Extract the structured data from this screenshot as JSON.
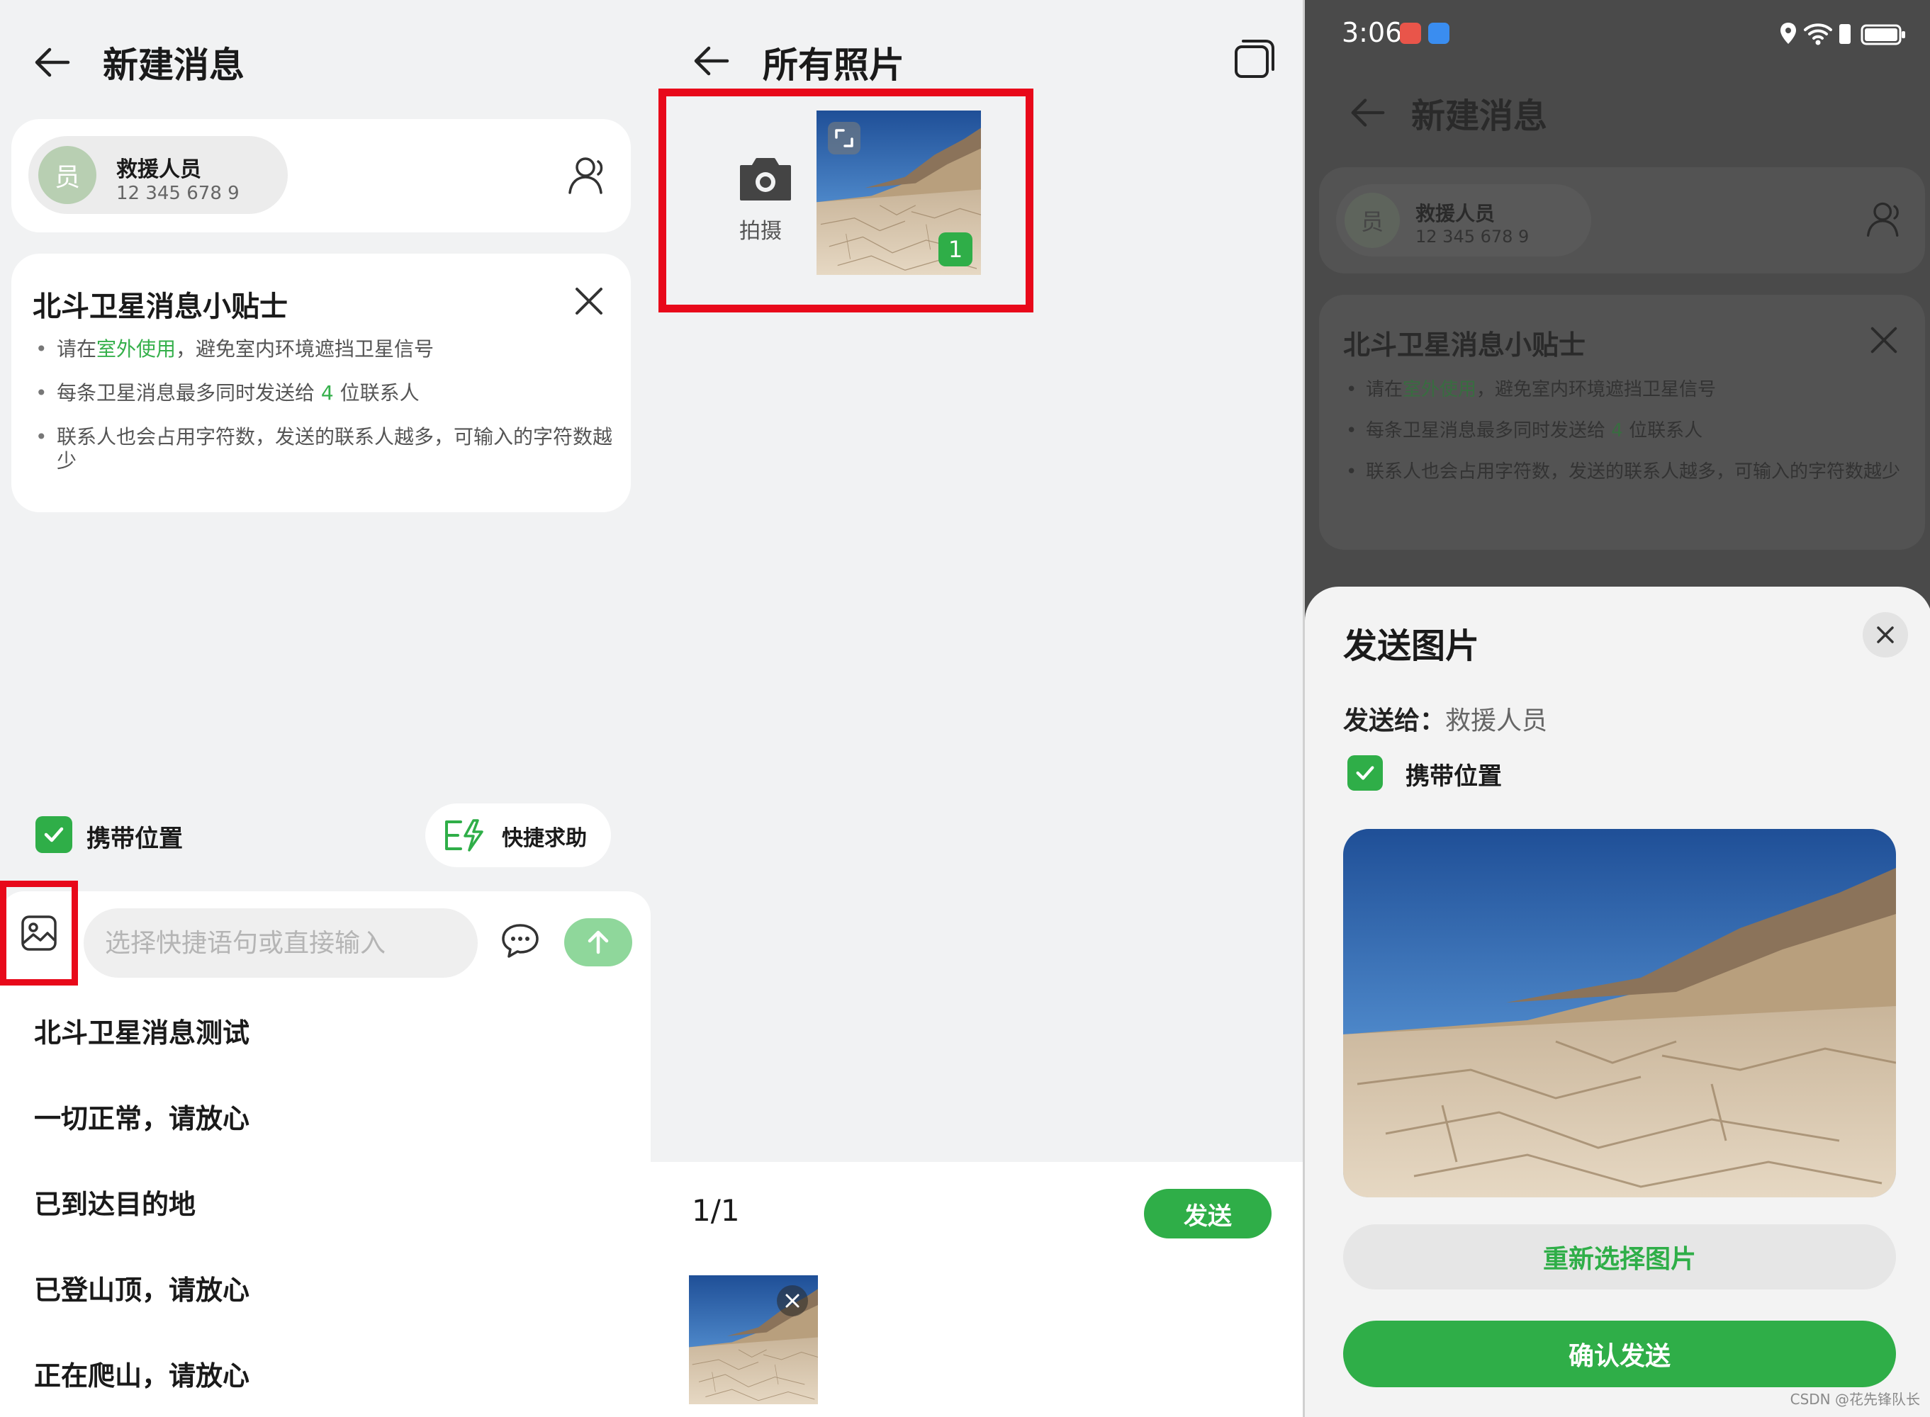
{
  "compose_screen": {
    "title": "新建消息",
    "recipient": {
      "avatar_char": "员",
      "name": "救援人员",
      "phone": "12 345 678 9"
    },
    "tips": {
      "title": "北斗卫星消息小贴士",
      "items": [
        {
          "pre": "请在",
          "highlight": "室外使用",
          "post": "，避免室内环境遮挡卫星信号"
        },
        {
          "pre": "每条卫星消息最多同时发送给 ",
          "highlight": "4",
          "post": " 位联系人"
        },
        {
          "pre": "联系人也会占用字符数，发送的联系人越多，可输入的字符数越少",
          "highlight": "",
          "post": ""
        }
      ]
    },
    "carry_location_label": "携带位置",
    "carry_location_checked": true,
    "quick_help_label": "快捷求助",
    "input_placeholder": "选择快捷语句或直接输入",
    "quick_phrases": [
      "北斗卫星消息测试",
      "一切正常，请放心",
      "已到达目的地",
      "已登山顶，请放心",
      "正在爬山，请放心"
    ]
  },
  "gallery_screen": {
    "title": "所有照片",
    "camera_label": "拍摄",
    "selected_badge": "1",
    "page_count": "1/1",
    "send_label": "发送"
  },
  "confirm_screen": {
    "status_time": "3:06",
    "title": "新建消息",
    "recipient": {
      "avatar_char": "员",
      "name": "救援人员",
      "phone": "12 345 678 9"
    },
    "tips": {
      "title": "北斗卫星消息小贴士",
      "items": [
        {
          "pre": "请在",
          "highlight": "室外使用",
          "post": "，避免室内环境遮挡卫星信号"
        },
        {
          "pre": "每条卫星消息最多同时发送给 ",
          "highlight": "4",
          "post": " 位联系人"
        },
        {
          "pre": "联系人也会占用字符数，发送的联系人越多，可输入的字符数越少",
          "highlight": "",
          "post": ""
        }
      ]
    },
    "sheet": {
      "title": "发送图片",
      "send_to_label": "发送给：",
      "send_to_name": "救援人员",
      "carry_location_label": "携带位置",
      "carry_location_checked": true,
      "reselect_label": "重新选择图片",
      "confirm_label": "确认发送"
    }
  },
  "watermark": "CSDN @花先锋队长",
  "colors": {
    "accent_green": "#2fae48",
    "highlight_red": "#e8091a",
    "send_disabled": "#8fd79b"
  }
}
